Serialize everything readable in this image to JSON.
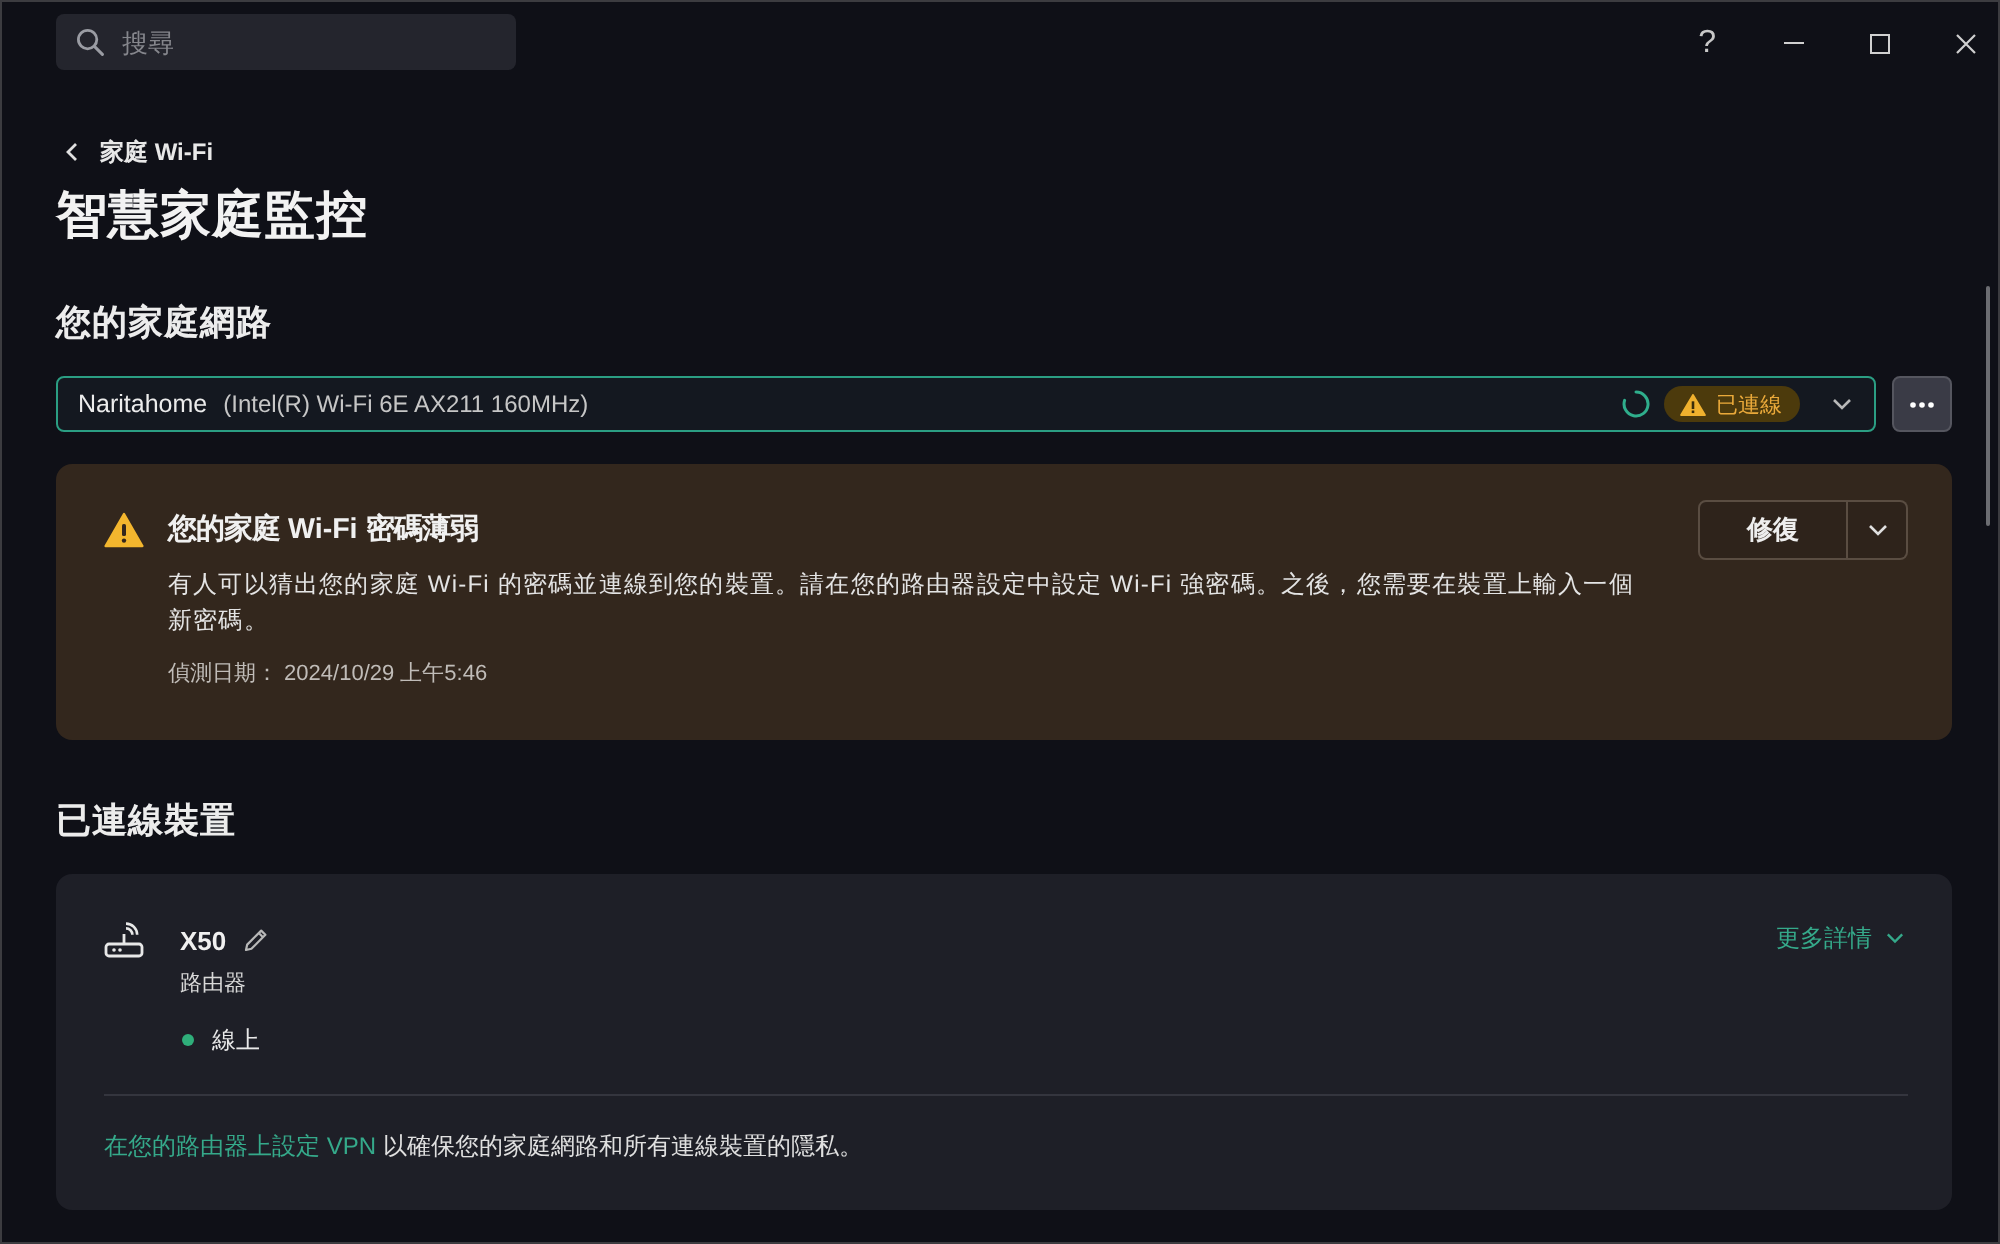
{
  "search": {
    "placeholder": "搜尋"
  },
  "window_controls": {
    "help": "?"
  },
  "breadcrumb": {
    "label": "家庭 Wi-Fi"
  },
  "title": "智慧家庭監控",
  "network_section": {
    "heading": "您的家庭網路",
    "network": {
      "name": "Naritahome",
      "adapter": "(Intel(R) Wi-Fi 6E AX211 160MHz)",
      "scanning": true,
      "status": {
        "label": "已連線",
        "kind": "warning"
      }
    }
  },
  "alerts": [
    {
      "kind": "warning",
      "title": "您的家庭 Wi-Fi 密碼薄弱",
      "description": "有人可以猜出您的家庭 Wi-Fi 的密碼並連線到您的裝置。請在您的路由器設定中設定 Wi-Fi 強密碼。之後，您需要在裝置上輸入一個新密碼。",
      "date": "偵測日期： 2024/10/29 上午5:46",
      "action": "修復"
    }
  ],
  "devices_section": {
    "heading": "已連線裝置",
    "devices": [
      {
        "kind": "router",
        "name": "X50",
        "type": "路由器",
        "status": "線上",
        "online": true,
        "details_link": "更多詳情"
      }
    ],
    "vpn_notice": {
      "link": "在您的路由器上設定 VPN",
      "text": "以確保您的家庭網路和所有連線裝置的隱私。"
    }
  }
}
